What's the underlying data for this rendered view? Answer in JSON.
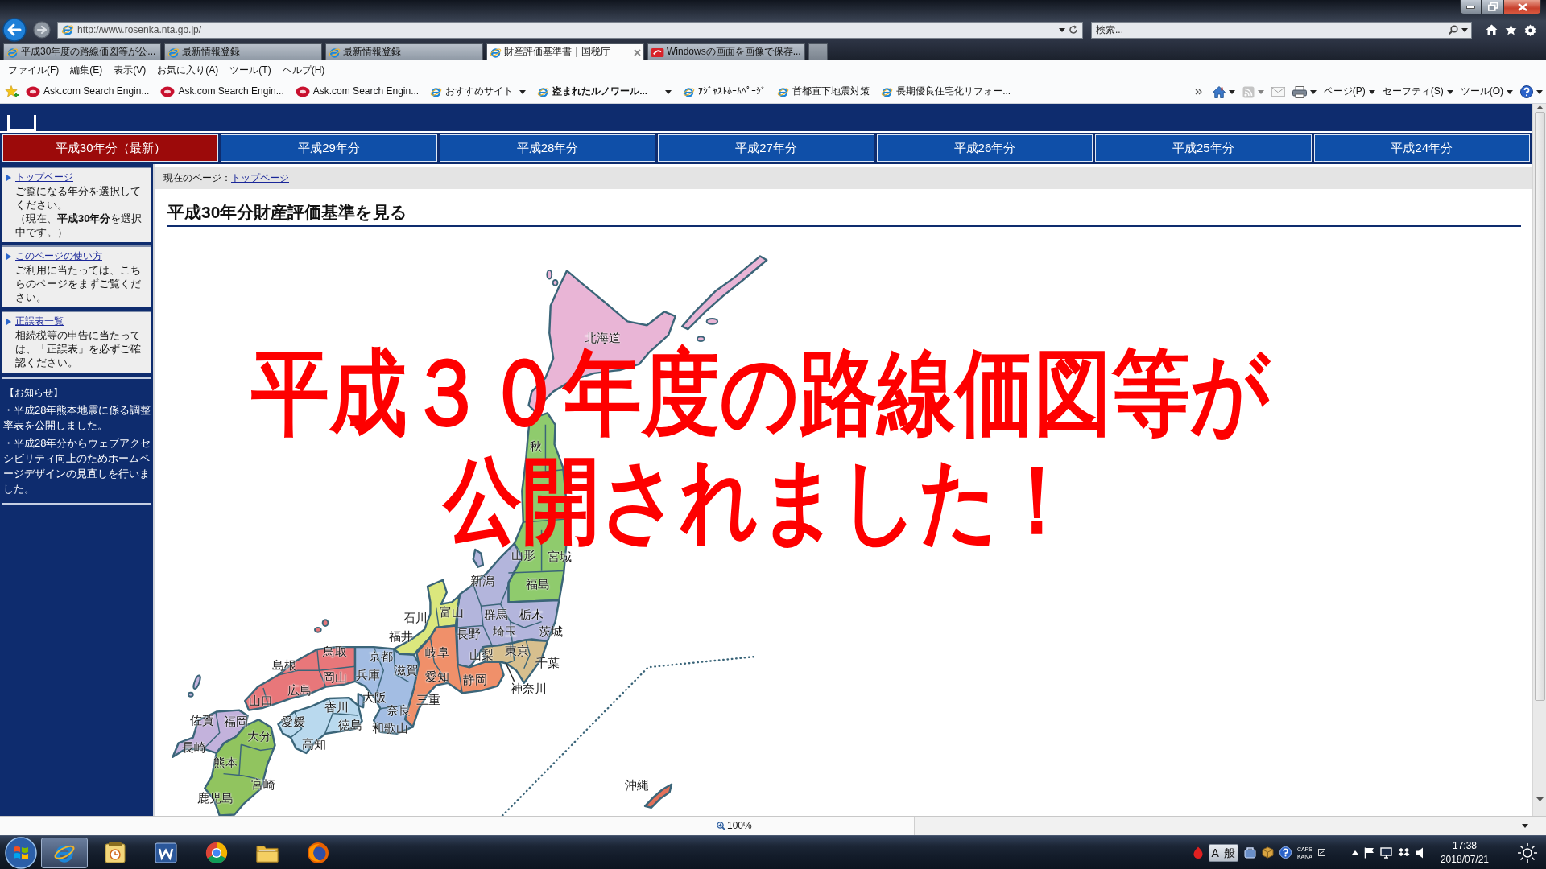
{
  "browser": {
    "address_bar": {
      "url": "http://www.rosenka.nta.go.jp/"
    },
    "search_box": {
      "placeholder": "検索..."
    },
    "tabs": [
      {
        "title": "平成30年度の路線価図等が公...",
        "kind": "ie",
        "selected": false
      },
      {
        "title": "最新情報登録",
        "kind": "ie",
        "selected": false
      },
      {
        "title": "最新情報登録",
        "kind": "ie",
        "selected": false
      },
      {
        "title": "財産評価基準書｜国税庁",
        "kind": "ie",
        "selected": true
      },
      {
        "title": "Windowsの画面を画像で保存...",
        "kind": "site",
        "selected": false
      }
    ],
    "menu": [
      "ファイル(F)",
      "編集(E)",
      "表示(V)",
      "お気に入り(A)",
      "ツール(T)",
      "ヘルプ(H)"
    ],
    "favorites": [
      {
        "label": "Ask.com Search Engin...",
        "kind": "ask",
        "dropdown": false,
        "unread": false
      },
      {
        "label": "Ask.com Search Engin...",
        "kind": "ask",
        "dropdown": false,
        "unread": false
      },
      {
        "label": "Ask.com Search Engin...",
        "kind": "ask",
        "dropdown": false,
        "unread": false
      },
      {
        "label": "おすすめサイト",
        "kind": "ie",
        "dropdown": true,
        "unread": false
      },
      {
        "label": "盗まれたルノワール...",
        "kind": "ie",
        "dropdown": true,
        "unread": true
      },
      {
        "label": "ｱｼﾞｬｽﾄﾎｰﾑﾍﾟｰｼﾞ",
        "kind": "ie",
        "dropdown": false,
        "unread": false
      },
      {
        "label": "首都直下地震対策",
        "kind": "ie",
        "dropdown": false,
        "unread": false
      },
      {
        "label": "長期優良住宅化リフォー...",
        "kind": "ie",
        "dropdown": false,
        "unread": false
      }
    ],
    "commands": [
      {
        "kind": "home",
        "dropdown": true,
        "disabled": false
      },
      {
        "kind": "feed",
        "dropdown": true,
        "disabled": true
      },
      {
        "kind": "mail",
        "dropdown": false,
        "disabled": true
      },
      {
        "kind": "print",
        "dropdown": true,
        "disabled": false
      },
      {
        "kind": "text",
        "label": "ページ(P)",
        "dropdown": true,
        "disabled": false
      },
      {
        "kind": "text",
        "label": "セーフティ(S)",
        "dropdown": true,
        "disabled": false
      },
      {
        "kind": "text",
        "label": "ツール(O)",
        "dropdown": true,
        "disabled": false
      },
      {
        "kind": "help",
        "dropdown": true,
        "disabled": false
      }
    ]
  },
  "site": {
    "year_tabs": [
      {
        "label": "平成30年分（最新）",
        "selected": true
      },
      {
        "label": "平成29年分",
        "selected": false
      },
      {
        "label": "平成28年分",
        "selected": false
      },
      {
        "label": "平成27年分",
        "selected": false
      },
      {
        "label": "平成26年分",
        "selected": false
      },
      {
        "label": "平成25年分",
        "selected": false
      },
      {
        "label": "平成24年分",
        "selected": false
      }
    ],
    "sidebar": {
      "boxes": [
        {
          "link": "トップページ",
          "paragraphs": [
            "ご覧になる年分を選択してください。",
            "（現在、**平成30年分**を選択中です。）"
          ]
        },
        {
          "link": "このページの使い方",
          "paragraphs": [
            "ご利用に当たっては、こちらのページをまずご覧ください。"
          ]
        },
        {
          "link": "正誤表一覧",
          "paragraphs": [
            "相続税等の申告に当たっては、「正誤表」を必ずご確認ください。"
          ]
        }
      ],
      "notice_title": "【お知らせ】",
      "notices": [
        "・平成28年熊本地震に係る調整率表を公開しました。",
        "・平成28年分からウェブアクセシビリティ向上のためホームページデザインの見直しを行いました。"
      ]
    },
    "breadcrumb": {
      "label": "現在のページ：",
      "link": "トップページ"
    },
    "heading": "平成30年分財産評価基準を見る",
    "map": {
      "labels": [
        "北海道",
        "秋",
        "山形",
        "宮城",
        "新潟",
        "福島",
        "石川",
        "富山",
        "群馬",
        "栃木",
        "福井",
        "長野",
        "埼玉",
        "茨城",
        "鳥取",
        "京都",
        "岐阜",
        "山梨",
        "東京",
        "島根",
        "千葉",
        "滋賀",
        "岡山",
        "兵庫",
        "愛知",
        "静岡",
        "広島",
        "神奈川",
        "山口",
        "大阪",
        "三重",
        "香川",
        "奈良",
        "佐賀",
        "福岡",
        "愛媛",
        "徳島",
        "和歌山",
        "大分",
        "長崎",
        "高知",
        "熊本",
        "宮崎",
        "沖縄",
        "鹿児島"
      ]
    }
  },
  "overlay": {
    "headline_lines": [
      "平成３０年度の路線価図等が",
      "公開されました！"
    ]
  },
  "status_bar": {
    "zoom": "100%"
  },
  "taskbar": {
    "apps": [
      {
        "kind": "ie",
        "selected": true
      },
      {
        "kind": "notes",
        "selected": false
      },
      {
        "kind": "word",
        "selected": false
      },
      {
        "kind": "chrome",
        "selected": false
      },
      {
        "kind": "folder",
        "selected": false
      },
      {
        "kind": "firefox",
        "selected": false
      }
    ],
    "ime": {
      "mode": "A",
      "input": "般"
    },
    "keys": [
      "CAPS",
      "KANA"
    ],
    "clock": {
      "time": "17:38",
      "date": "2018/07/21"
    }
  }
}
